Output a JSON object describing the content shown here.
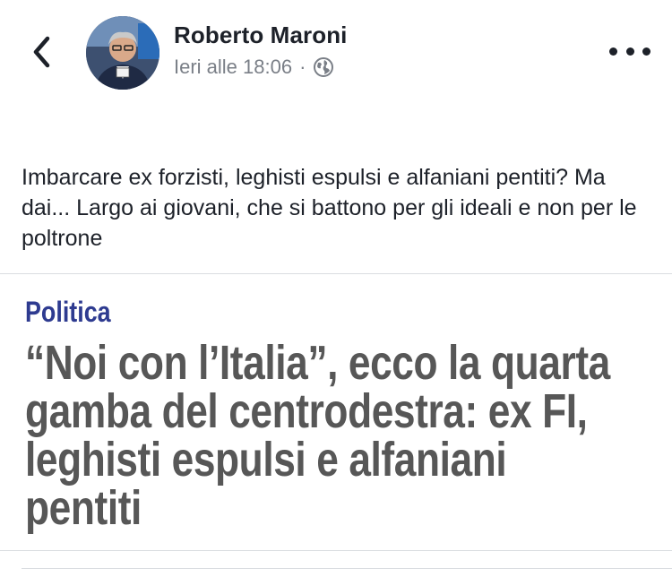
{
  "post": {
    "author": "Roberto Maroni",
    "timestamp": "Ieri alle 18:06",
    "separator": "·",
    "audience_icon": "globe-icon",
    "text": "Imbarcare ex forzisti, leghisti espulsi e alfaniani pentiti? Ma dai... Largo ai giovani, che si battono per gli ideali e non per le poltrone"
  },
  "nav": {
    "back_icon": "chevron-left-icon",
    "more_icon": "more-horizontal-icon"
  },
  "link_preview": {
    "category": "Politica",
    "headline_lines": [
      "“Noi con l’Italia”, ecco la quarta",
      "gamba del centrodestra: ex FI,",
      "leghisti espulsi e alfaniani",
      "pentiti"
    ]
  },
  "colors": {
    "category": "#2e3b90",
    "headline": "#575757",
    "meta": "#7a7f87",
    "text": "#1d2129"
  }
}
